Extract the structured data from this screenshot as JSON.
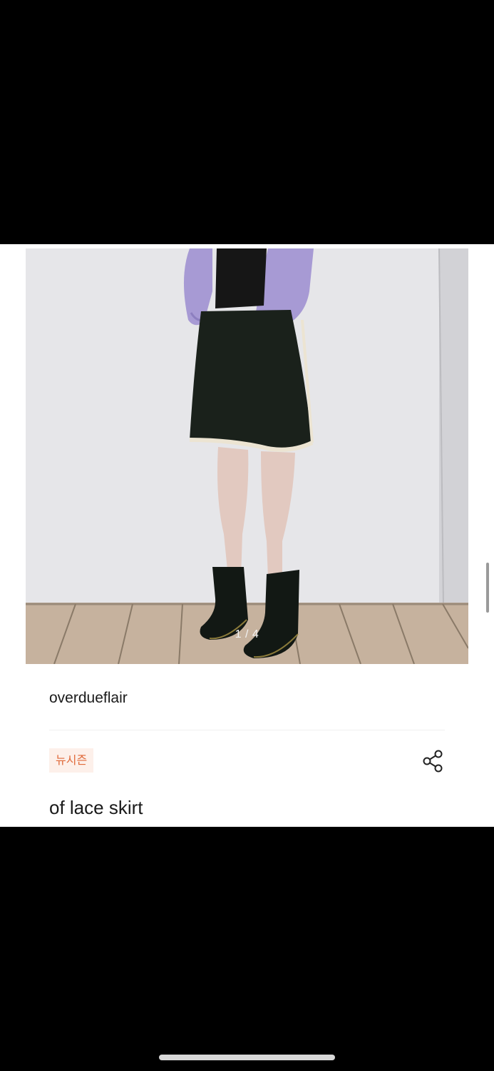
{
  "product": {
    "image_counter": "1 / 4",
    "brand": "overdueflair",
    "badge": "뉴시즌",
    "title": "of lace skirt"
  },
  "icons": {
    "share": "share-icon"
  },
  "colors": {
    "badge_bg": "#fdf0ea",
    "badge_text": "#e06a3a",
    "background": "#000000"
  }
}
